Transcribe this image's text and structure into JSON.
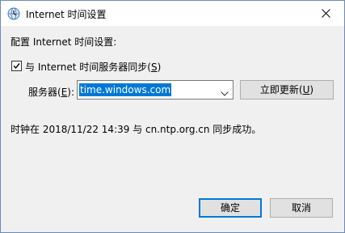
{
  "window": {
    "title": "Internet 时间设置",
    "icon": "clock-globe-icon",
    "close_icon": "close-icon"
  },
  "config": {
    "heading": "配置 Internet 时间设置:",
    "sync_checked": true,
    "sync_label_prefix": "与 Internet 时间服务器同步(",
    "sync_label_key": "S",
    "sync_label_suffix": ")",
    "server_label_prefix": "服务器(",
    "server_label_key": "E",
    "server_label_suffix": "):",
    "server_value": "time.windows.com",
    "update_button_prefix": "立即更新(",
    "update_button_key": "U",
    "update_button_suffix": ")"
  },
  "status": {
    "message": "时钟在 2018/11/22 14:39 与 cn.ntp.org.cn 同步成功。"
  },
  "buttons": {
    "ok": "确定",
    "cancel": "取消"
  },
  "colors": {
    "accent": "#0078d7",
    "button_face": "#e1e1e1",
    "dialog_background": "#f0f0f0"
  }
}
